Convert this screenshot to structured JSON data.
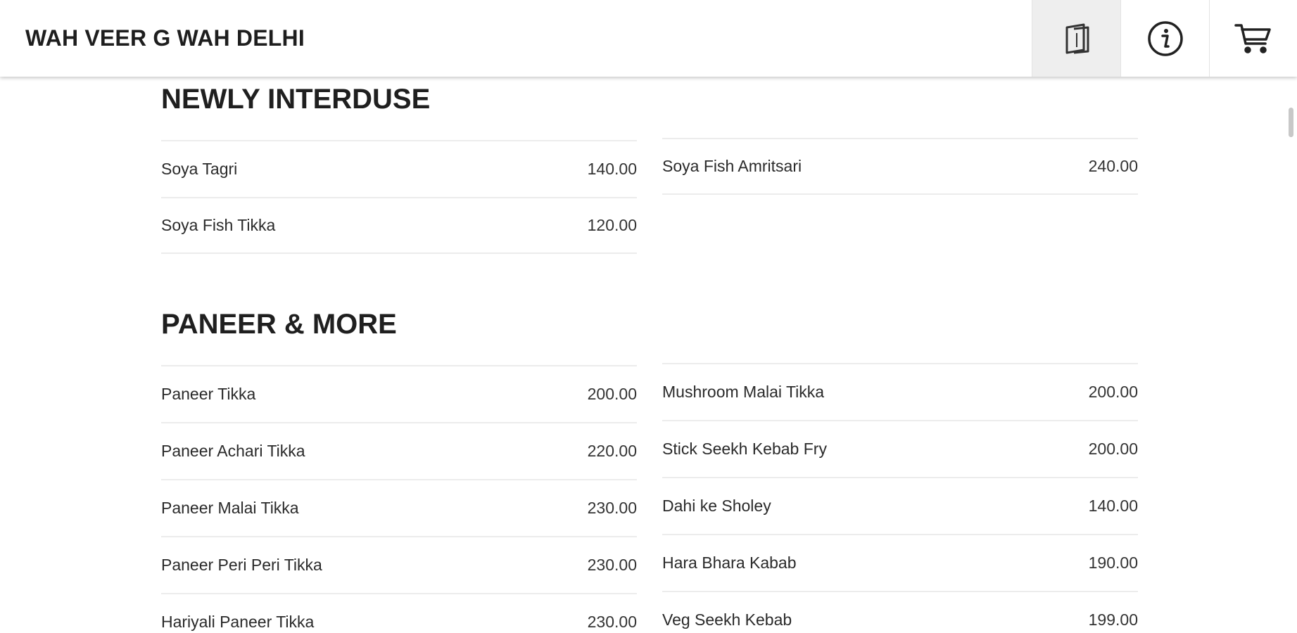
{
  "header": {
    "title": "WAH VEER G WAH DELHI",
    "buttons": [
      {
        "icon": "menu-book-icon",
        "active": true
      },
      {
        "icon": "info-icon",
        "active": false
      },
      {
        "icon": "cart-icon",
        "active": false
      }
    ]
  },
  "sections": [
    {
      "title": "NEWLY INTERDUSE",
      "left": [
        {
          "name": "Soya Tagri",
          "price": "140.00"
        },
        {
          "name": "Soya Fish Tikka",
          "price": "120.00"
        }
      ],
      "right": [
        {
          "name": "Soya Fish Amritsari",
          "price": "240.00"
        }
      ]
    },
    {
      "title": "PANEER & MORE",
      "left": [
        {
          "name": "Paneer Tikka",
          "price": "200.00"
        },
        {
          "name": "Paneer Achari Tikka",
          "price": "220.00"
        },
        {
          "name": "Paneer Malai Tikka",
          "price": "230.00"
        },
        {
          "name": "Paneer Peri Peri Tikka",
          "price": "230.00"
        },
        {
          "name": "Hariyali Paneer Tikka",
          "price": "230.00"
        }
      ],
      "right": [
        {
          "name": "Mushroom Malai Tikka",
          "price": "200.00"
        },
        {
          "name": "Stick Seekh Kebab Fry",
          "price": "200.00"
        },
        {
          "name": "Dahi ke Sholey",
          "price": "140.00"
        },
        {
          "name": "Hara Bhara Kabab",
          "price": "190.00"
        },
        {
          "name": "Veg Seekh Kebab",
          "price": "199.00"
        }
      ]
    }
  ]
}
